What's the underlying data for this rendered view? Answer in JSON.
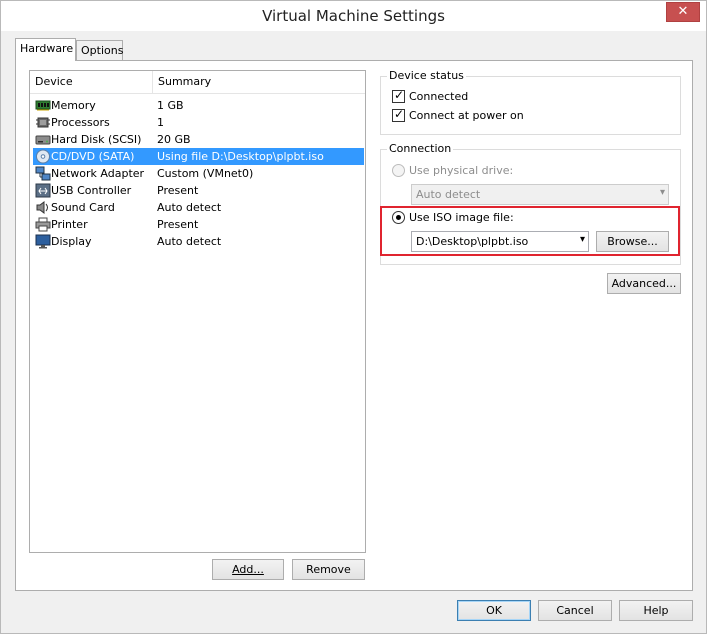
{
  "window": {
    "title": "Virtual Machine Settings",
    "close_glyph": "✕"
  },
  "tabs": [
    {
      "label": "Hardware",
      "active": true
    },
    {
      "label": "Options",
      "active": false
    }
  ],
  "device_list": {
    "columns": [
      "Device",
      "Summary"
    ],
    "rows": [
      {
        "device": "Memory",
        "summary": "1 GB",
        "icon": "memory-icon"
      },
      {
        "device": "Processors",
        "summary": "1",
        "icon": "processor-icon"
      },
      {
        "device": "Hard Disk (SCSI)",
        "summary": "20 GB",
        "icon": "hard-disk-icon"
      },
      {
        "device": "CD/DVD (SATA)",
        "summary": "Using file D:\\Desktop\\plpbt.iso",
        "icon": "cd-dvd-icon",
        "selected": true
      },
      {
        "device": "Network Adapter",
        "summary": "Custom (VMnet0)",
        "icon": "network-adapter-icon"
      },
      {
        "device": "USB Controller",
        "summary": "Present",
        "icon": "usb-controller-icon"
      },
      {
        "device": "Sound Card",
        "summary": "Auto detect",
        "icon": "sound-card-icon"
      },
      {
        "device": "Printer",
        "summary": "Present",
        "icon": "printer-icon"
      },
      {
        "device": "Display",
        "summary": "Auto detect",
        "icon": "display-icon"
      }
    ],
    "add_label": "Add...",
    "remove_label": "Remove"
  },
  "device_status": {
    "label": "Device status",
    "connected_label": "Connected",
    "connected": true,
    "connect_power_on_label": "Connect at power on",
    "connect_power_on": true
  },
  "connection": {
    "label": "Connection",
    "physical_label": "Use physical drive:",
    "physical_value": "Auto detect",
    "iso_label": "Use ISO image file:",
    "iso_value": "D:\\Desktop\\plpbt.iso",
    "browse_label": "Browse..."
  },
  "advanced_label": "Advanced...",
  "footer": {
    "ok_label": "OK",
    "cancel_label": "Cancel",
    "help_label": "Help"
  },
  "colors": {
    "selection": "#3399ff",
    "highlight_border": "#e0242f",
    "close_button": "#c75050"
  }
}
